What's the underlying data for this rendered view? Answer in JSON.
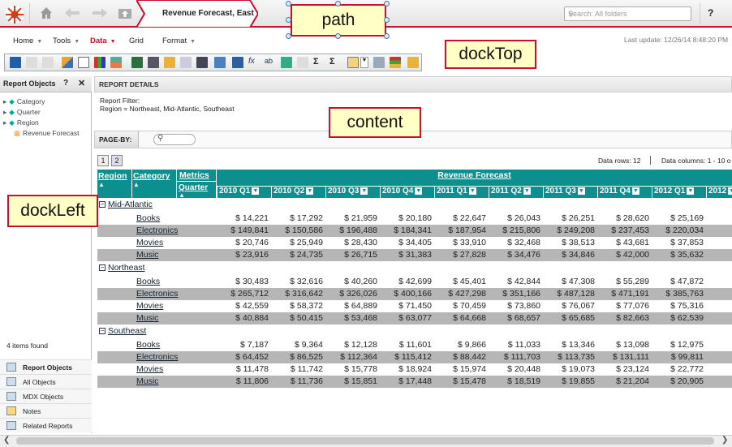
{
  "topbar": {
    "report_title": "Revenue Forecast, East",
    "search_placeholder": "Search: All folders",
    "help_label": "?"
  },
  "menu": {
    "items": [
      "Home",
      "Tools",
      "Data",
      "Grid",
      "Format"
    ],
    "last_update": "Last update: 12/26/14 8:48:20 PM"
  },
  "left_panel": {
    "title": "Report Objects",
    "tree": [
      "Category",
      "Quarter",
      "Region",
      "Revenue Forecast"
    ],
    "items_found": "4 items found",
    "bottom_nav": [
      "Report Objects",
      "All Objects",
      "MDX Objects",
      "Notes",
      "Related Reports"
    ]
  },
  "report_details": {
    "title": "REPORT DETAILS",
    "filter_label": "Report Filter:",
    "filter_value": "Region = Northeast, Mid-Atlantic, Southeast"
  },
  "page_by": {
    "label": "PAGE-BY:",
    "pages": [
      "1",
      "2"
    ],
    "data_rows": "Data rows: 12",
    "data_columns": "Data columns: 1 - 10 o"
  },
  "grid": {
    "headers": {
      "region": "Region",
      "category": "Category",
      "metrics": "Metrics",
      "quarter": "Quarter",
      "metric": "Revenue Forecast"
    },
    "quarters": [
      "2010 Q1",
      "2010 Q2",
      "2010 Q3",
      "2010 Q4",
      "2011 Q1",
      "2011 Q2",
      "2011 Q3",
      "2011 Q4",
      "2012 Q1",
      "2012"
    ],
    "regions": [
      {
        "name": "Mid-Atlantic",
        "rows": [
          {
            "category": "Books",
            "values": [
              "$ 14,221",
              "$ 17,292",
              "$ 21,959",
              "$ 20,180",
              "$ 22,647",
              "$ 26,043",
              "$ 26,251",
              "$ 28,620",
              "$ 25,169",
              "$ 2"
            ]
          },
          {
            "category": "Electronics",
            "values": [
              "$ 149,841",
              "$ 150,586",
              "$ 196,488",
              "$ 184,341",
              "$ 187,954",
              "$ 215,806",
              "$ 249,208",
              "$ 237,453",
              "$ 220,034",
              "$ 25"
            ]
          },
          {
            "category": "Movies",
            "values": [
              "$ 20,746",
              "$ 25,949",
              "$ 28,430",
              "$ 34,405",
              "$ 33,910",
              "$ 32,468",
              "$ 38,513",
              "$ 43,681",
              "$ 37,853",
              "$ 4"
            ]
          },
          {
            "category": "Music",
            "values": [
              "$ 23,916",
              "$ 24,735",
              "$ 26,715",
              "$ 31,383",
              "$ 27,828",
              "$ 34,476",
              "$ 34,846",
              "$ 42,000",
              "$ 35,632",
              "$ 4"
            ]
          }
        ]
      },
      {
        "name": "Northeast",
        "rows": [
          {
            "category": "Books",
            "values": [
              "$ 30,483",
              "$ 32,616",
              "$ 40,260",
              "$ 42,699",
              "$ 45,401",
              "$ 42,844",
              "$ 47,308",
              "$ 55,289",
              "$ 47,872",
              "$ 6"
            ]
          },
          {
            "category": "Electronics",
            "values": [
              "$ 265,712",
              "$ 316,642",
              "$ 326,026",
              "$ 400,166",
              "$ 427,298",
              "$ 351,166",
              "$ 487,128",
              "$ 471,191",
              "$ 385,763",
              "$ 48"
            ]
          },
          {
            "category": "Movies",
            "values": [
              "$ 42,559",
              "$ 58,372",
              "$ 64,889",
              "$ 71,450",
              "$ 70,459",
              "$ 73,860",
              "$ 76,067",
              "$ 77,076",
              "$ 75,316",
              "$ 8"
            ]
          },
          {
            "category": "Music",
            "values": [
              "$ 40,884",
              "$ 50,415",
              "$ 53,468",
              "$ 63,077",
              "$ 64,668",
              "$ 68,657",
              "$ 65,685",
              "$ 82,663",
              "$ 62,539",
              "$ 8"
            ]
          }
        ]
      },
      {
        "name": "Southeast",
        "rows": [
          {
            "category": "Books",
            "values": [
              "$ 7,187",
              "$ 9,364",
              "$ 12,128",
              "$ 11,601",
              "$ 9,866",
              "$ 11,033",
              "$ 13,346",
              "$ 13,098",
              "$ 12,975",
              "$ 1"
            ]
          },
          {
            "category": "Electronics",
            "values": [
              "$ 64,452",
              "$ 86,525",
              "$ 112,364",
              "$ 115,412",
              "$ 88,442",
              "$ 111,703",
              "$ 113,735",
              "$ 131,111",
              "$ 99,811",
              "$ 12"
            ]
          },
          {
            "category": "Movies",
            "values": [
              "$ 11,478",
              "$ 11,742",
              "$ 15,778",
              "$ 18,924",
              "$ 15,974",
              "$ 20,448",
              "$ 19,073",
              "$ 23,124",
              "$ 22,772",
              "$ 1"
            ]
          },
          {
            "category": "Music",
            "values": [
              "$ 11,806",
              "$ 11,736",
              "$ 15,851",
              "$ 17,448",
              "$ 15,478",
              "$ 18,519",
              "$ 19,855",
              "$ 21,204",
              "$ 20,905",
              "$ 2"
            ]
          }
        ]
      }
    ]
  },
  "annotations": [
    "path",
    "dockTop",
    "content",
    "dockLeft"
  ],
  "colors": {
    "teal_header": "#0d8f8f",
    "accent_red": "#c8102e",
    "callout_fill": "#ffffc6",
    "alt_row": "#b6b6b6"
  }
}
